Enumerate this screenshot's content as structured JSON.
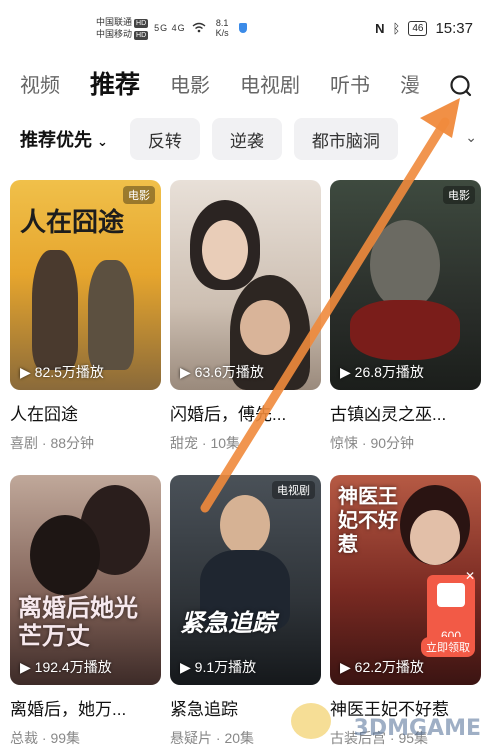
{
  "status_bar": {
    "carrier1": "中国联通",
    "carrier2": "中国移动",
    "hd": "HD",
    "signal": "5G 4G",
    "net_speed": "8.1",
    "net_unit": "K/s",
    "battery": "46",
    "time": "15:37"
  },
  "tabs": [
    "视频",
    "推荐",
    "电影",
    "电视剧",
    "听书",
    "漫"
  ],
  "active_tab": "推荐",
  "filters": {
    "main": "推荐优先",
    "chips": [
      "反转",
      "逆袭",
      "都市脑洞"
    ]
  },
  "cards": [
    {
      "title": "人在囧途",
      "meta": "喜剧 · 88分钟",
      "plays": "82.5万播放",
      "badge": "电影",
      "overlay": "人在囧途"
    },
    {
      "title": "闪婚后，傅先...",
      "meta": "甜宠 · 10集",
      "plays": "63.6万播放",
      "badge": "",
      "overlay": ""
    },
    {
      "title": "古镇凶灵之巫...",
      "meta": "惊悚 · 90分钟",
      "plays": "26.8万播放",
      "badge": "电影",
      "overlay": ""
    },
    {
      "title": "离婚后，她万...",
      "meta": "总裁 · 99集",
      "plays": "192.4万播放",
      "badge": "",
      "overlay": "离婚后她光芒万丈"
    },
    {
      "title": "紧急追踪",
      "meta": "悬疑片 · 20集",
      "plays": "9.1万播放",
      "badge": "电视剧",
      "overlay": "紧急追踪"
    },
    {
      "title": "神医王妃不好惹",
      "meta": "古装后宫 · 95集",
      "plays": "62.2万播放",
      "badge": "",
      "overlay": "神医王妃不好惹"
    }
  ],
  "promo": {
    "amount": "600",
    "claim": "立即领取"
  },
  "watermark": "3DMGAME",
  "colors": {
    "accent_arrow": "#f08a3c",
    "promo_red": "#f25a46"
  }
}
